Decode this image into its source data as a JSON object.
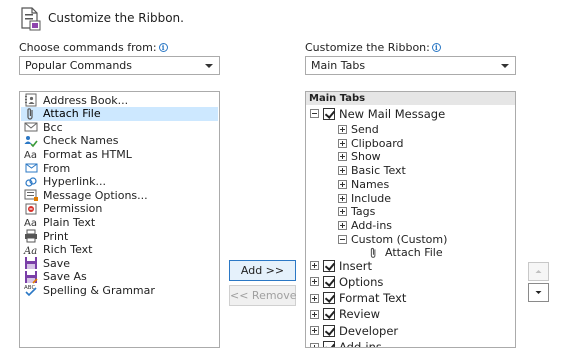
{
  "dialog": {
    "title": "Customize the Ribbon.",
    "icon": "customize-ribbon-icon"
  },
  "left": {
    "label": "Choose commands from:",
    "combo_value": "Popular Commands",
    "items": [
      {
        "label": "Address Book...",
        "icon": "address-book-icon"
      },
      {
        "label": "Attach File",
        "icon": "attach-file-icon"
      },
      {
        "label": "Bcc",
        "icon": "bcc-icon"
      },
      {
        "label": "Check Names",
        "icon": "check-names-icon"
      },
      {
        "label": "Format as HTML",
        "icon": "format-html-icon"
      },
      {
        "label": "From",
        "icon": "from-icon"
      },
      {
        "label": "Hyperlink...",
        "icon": "hyperlink-icon"
      },
      {
        "label": "Message Options...",
        "icon": "message-options-icon"
      },
      {
        "label": "Permission",
        "icon": "permission-icon"
      },
      {
        "label": "Plain Text",
        "icon": "plain-text-icon"
      },
      {
        "label": "Print",
        "icon": "print-icon"
      },
      {
        "label": "Rich Text",
        "icon": "rich-text-icon"
      },
      {
        "label": "Save",
        "icon": "save-icon"
      },
      {
        "label": "Save As",
        "icon": "save-as-icon"
      },
      {
        "label": "Spelling & Grammar",
        "icon": "spelling-icon"
      }
    ]
  },
  "middle": {
    "add_label": "Add >>",
    "remove_label": "<< Remove"
  },
  "right": {
    "label": "Customize the Ribbon:",
    "combo_value": "Main Tabs",
    "tree_header": "Main Tabs",
    "root": "New Mail Message",
    "groups": [
      "Send",
      "Clipboard",
      "Show",
      "Basic Text",
      "Names",
      "Include",
      "Tags",
      "Add-ins"
    ],
    "custom_group": "Custom (Custom)",
    "custom_item": "Attach File",
    "tabs": [
      "Insert",
      "Options",
      "Format Text",
      "Review",
      "Developer",
      "Add-ins"
    ]
  },
  "colors": {
    "accent": "#2b78c5",
    "selection": "#cde8ff",
    "border": "#ababab"
  }
}
